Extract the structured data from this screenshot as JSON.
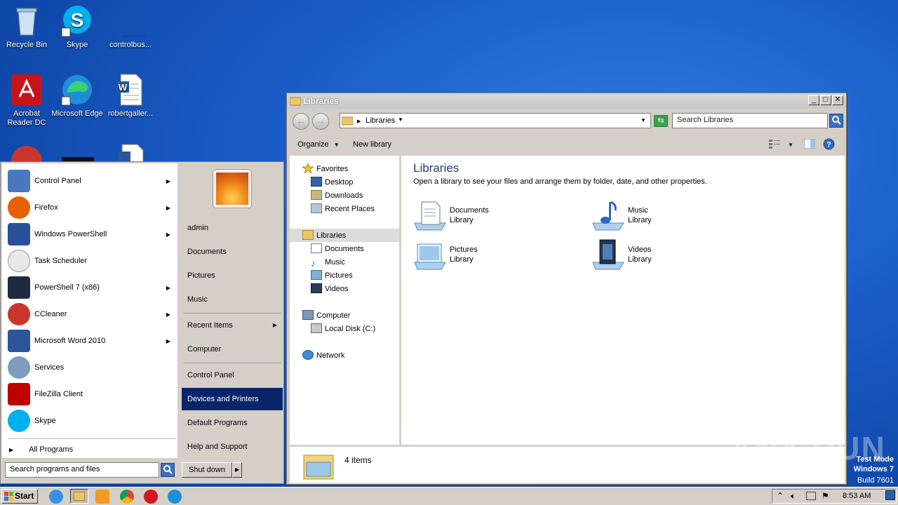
{
  "desktop": {
    "icons": [
      {
        "label": "Recycle Bin"
      },
      {
        "label": "Skype"
      },
      {
        "label": "controlbus..."
      },
      {
        "label": "Acrobat Reader DC"
      },
      {
        "label": "Microsoft Edge"
      },
      {
        "label": "robertgaller..."
      }
    ],
    "watermark": {
      "line1": "Test Mode",
      "line2": "Windows 7",
      "line3": "Build 7601"
    },
    "brand": "ANY RUN"
  },
  "explorer": {
    "title": "Libraries",
    "address": {
      "crumb": "Libraries"
    },
    "search": {
      "placeholder": "Search Libraries"
    },
    "toolbar": {
      "organize": "Organize",
      "new_library": "New library"
    },
    "nav": {
      "favorites": "Favorites",
      "desktop": "Desktop",
      "downloads": "Downloads",
      "recent_places": "Recent Places",
      "libraries": "Libraries",
      "documents": "Documents",
      "music": "Music",
      "pictures": "Pictures",
      "videos": "Videos",
      "computer": "Computer",
      "local_disk": "Local Disk (C:)",
      "network": "Network"
    },
    "content": {
      "heading": "Libraries",
      "subheading": "Open a library to see your files and arrange them by folder, date, and other properties.",
      "libraries": [
        {
          "name": "Documents",
          "type": "Library"
        },
        {
          "name": "Music",
          "type": "Library"
        },
        {
          "name": "Pictures",
          "type": "Library"
        },
        {
          "name": "Videos",
          "type": "Library"
        }
      ]
    },
    "details": {
      "count": "4 items"
    }
  },
  "start_menu": {
    "programs": [
      {
        "label": "Control Panel",
        "icon": "control-panel-icon",
        "color": "#4a78c0"
      },
      {
        "label": "Firefox",
        "icon": "firefox-icon",
        "color": "#e66000"
      },
      {
        "label": "Windows PowerShell",
        "icon": "powershell-icon",
        "color": "#2a4f9a"
      },
      {
        "label": "Task Scheduler",
        "icon": "clock-icon",
        "color": "#c9c9c9"
      },
      {
        "label": "PowerShell 7 (x86)",
        "icon": "powershell7-icon",
        "color": "#1e2b3f"
      },
      {
        "label": "CCleaner",
        "icon": "ccleaner-icon",
        "color": "#c8372d"
      },
      {
        "label": "Microsoft Word 2010",
        "icon": "word-icon",
        "color": "#2b579a"
      },
      {
        "label": "Services",
        "icon": "gear-icon",
        "color": "#7d9dbd"
      },
      {
        "label": "FileZilla Client",
        "icon": "filezilla-icon",
        "color": "#bf0000"
      },
      {
        "label": "Skype",
        "icon": "skype-icon",
        "color": "#00aff0"
      }
    ],
    "all_programs": "All Programs",
    "search_placeholder": "Search programs and files",
    "right": {
      "user": "admin",
      "documents": "Documents",
      "pictures": "Pictures",
      "music": "Music",
      "recent_items": "Recent Items",
      "computer": "Computer",
      "control_panel": "Control Panel",
      "devices_printers": "Devices and Printers",
      "default_programs": "Default Programs",
      "help_support": "Help and Support"
    },
    "shutdown": "Shut down"
  },
  "taskbar": {
    "start": "Start",
    "clock": "8:53 AM"
  }
}
